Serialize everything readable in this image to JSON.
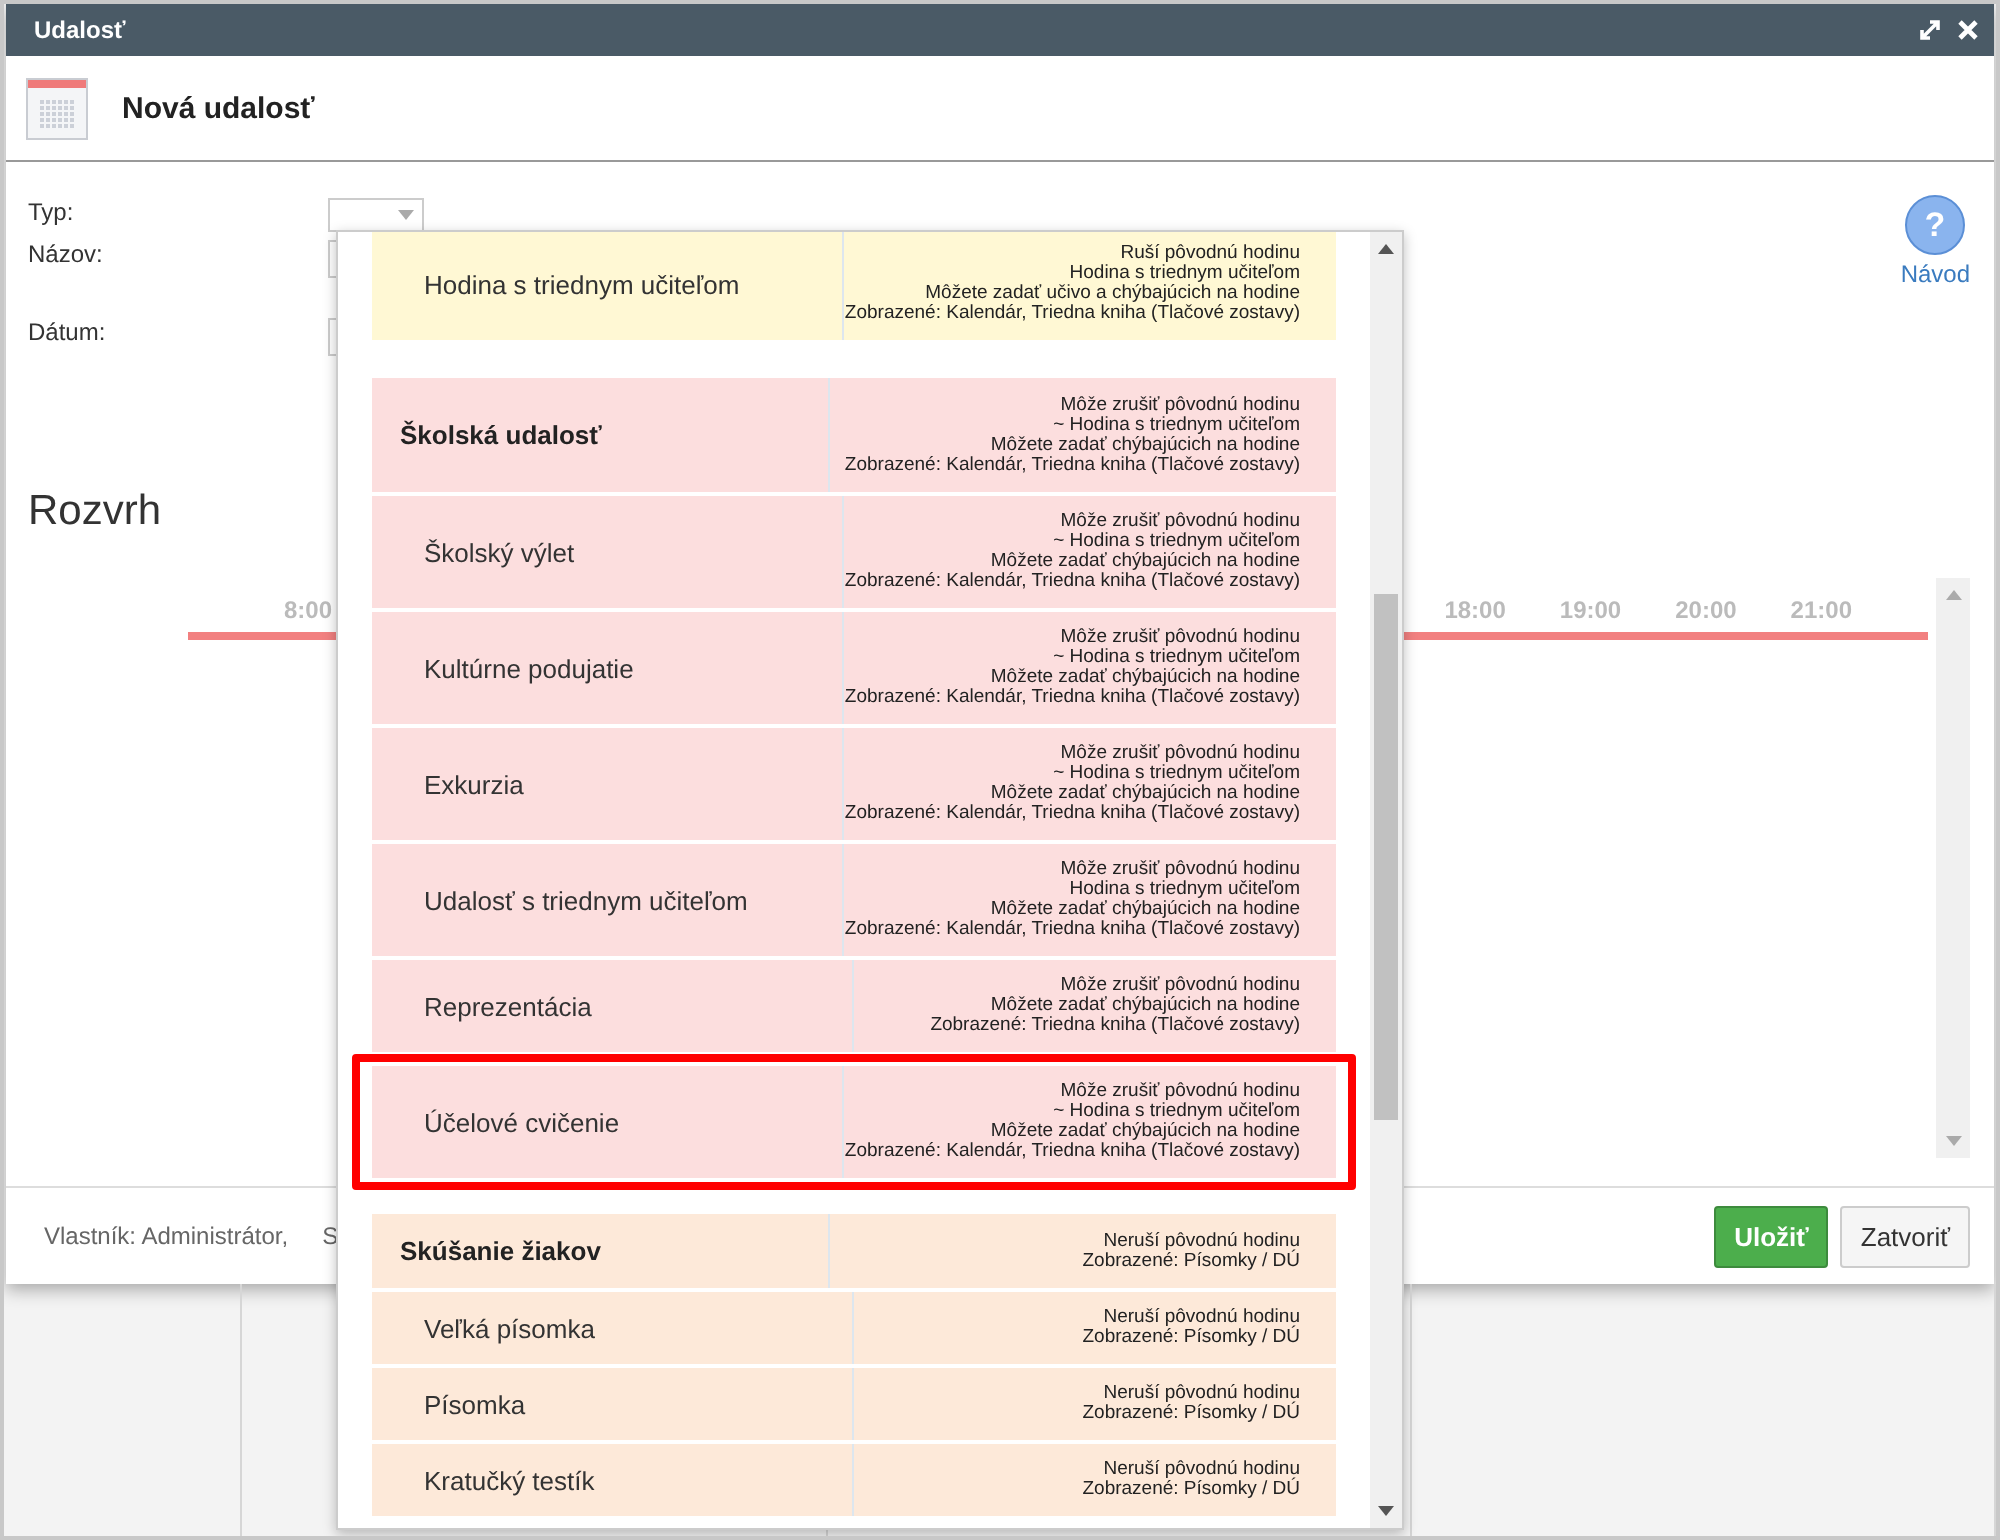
{
  "window": {
    "title": "Udalosť"
  },
  "header": {
    "title": "Nová udalosť"
  },
  "form": {
    "fields": [
      {
        "label": "Typ:",
        "kind": "select"
      },
      {
        "label": "Názov:",
        "kind": "text"
      },
      {
        "label": "Dátum:",
        "kind": "date"
      }
    ]
  },
  "help": {
    "symbol": "?",
    "label": "Návod"
  },
  "schedule": {
    "title": "Rozvrh",
    "times": [
      "8:00",
      "18:00",
      "19:00",
      "20:00",
      "21:00"
    ]
  },
  "footer": {
    "owner": "Vlastník: Administrátor,",
    "cut_text": "S",
    "buttons": [
      {
        "label": "Uložiť",
        "kind": "primary"
      },
      {
        "label": "Zatvoriť",
        "kind": "secondary"
      }
    ]
  },
  "dropdown": {
    "groups": [
      {
        "color": "#fff8d4",
        "items": [
          {
            "label": "Hodina s triednym učiteľom",
            "highlighted": false,
            "lines": [
              "Ruší pôvodnú hodinu",
              "Hodina s triednym učiteľom",
              "Môžete zadať učivo a chýbajúcich na hodine",
              "Zobrazené: Kalendár, Triedna kniha (Tlačové zostavy)"
            ]
          }
        ]
      },
      {
        "color": "#fcdede",
        "header": {
          "label": "Školská udalosť",
          "lines": [
            "Môže zrušiť pôvodnú hodinu",
            "~ Hodina s triednym učiteľom",
            "Môžete zadať chýbajúcich na hodine",
            "Zobrazené: Kalendár, Triedna kniha (Tlačové zostavy)"
          ]
        },
        "items": [
          {
            "label": "Školský výlet",
            "highlighted": false,
            "lines": [
              "Môže zrušiť pôvodnú hodinu",
              "~ Hodina s triednym učiteľom",
              "Môžete zadať chýbajúcich na hodine",
              "Zobrazené: Kalendár, Triedna kniha (Tlačové zostavy)"
            ]
          },
          {
            "label": "Kultúrne podujatie",
            "highlighted": false,
            "lines": [
              "Môže zrušiť pôvodnú hodinu",
              "~ Hodina s triednym učiteľom",
              "Môžete zadať chýbajúcich na hodine",
              "Zobrazené: Kalendár, Triedna kniha (Tlačové zostavy)"
            ]
          },
          {
            "label": "Exkurzia",
            "highlighted": false,
            "lines": [
              "Môže zrušiť pôvodnú hodinu",
              "~ Hodina s triednym učiteľom",
              "Môžete zadať chýbajúcich na hodine",
              "Zobrazené: Kalendár, Triedna kniha (Tlačové zostavy)"
            ]
          },
          {
            "label": "Udalosť s triednym učiteľom",
            "highlighted": false,
            "lines": [
              "Môže zrušiť pôvodnú hodinu",
              "Hodina s triednym učiteľom",
              "Môžete zadať chýbajúcich na hodine",
              "Zobrazené: Kalendár, Triedna kniha (Tlačové zostavy)"
            ]
          },
          {
            "label": "Reprezentácia",
            "highlighted": false,
            "lines": [
              "Môže zrušiť pôvodnú hodinu",
              "Môžete zadať chýbajúcich na hodine",
              "Zobrazené: Triedna kniha (Tlačové zostavy)"
            ]
          },
          {
            "label": "Účelové cvičenie",
            "highlighted": true,
            "lines": [
              "Môže zrušiť pôvodnú hodinu",
              "~ Hodina s triednym učiteľom",
              "Môžete zadať chýbajúcich na hodine",
              "Zobrazené: Kalendár, Triedna kniha (Tlačové zostavy)"
            ]
          }
        ]
      },
      {
        "color": "#fde9d9",
        "header": {
          "label": "Skúšanie žiakov",
          "lines": [
            "Neruší pôvodnú hodinu",
            "Zobrazené: Písomky / DÚ"
          ]
        },
        "items": [
          {
            "label": "Veľká písomka",
            "highlighted": false,
            "lines": [
              "Neruší pôvodnú hodinu",
              "Zobrazené: Písomky / DÚ"
            ]
          },
          {
            "label": "Písomka",
            "highlighted": false,
            "lines": [
              "Neruší pôvodnú hodinu",
              "Zobrazené: Písomky / DÚ"
            ]
          },
          {
            "label": "Kratučký testík",
            "highlighted": false,
            "lines": [
              "Neruší pôvodnú hodinu",
              "Zobrazené: Písomky / DÚ"
            ]
          }
        ]
      }
    ]
  }
}
